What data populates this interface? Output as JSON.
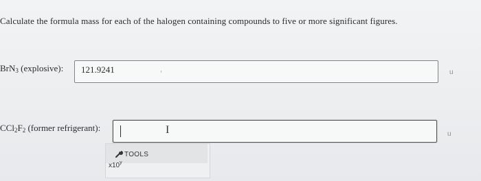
{
  "question": {
    "text": "Calculate the formula mass for each of the halogen containing compounds to five or more significant figures."
  },
  "rows": [
    {
      "formula_parts": [
        "BrN",
        "3"
      ],
      "descriptor": "(explosive):",
      "value": "121.9241",
      "unit": "u"
    },
    {
      "formula_parts": [
        "CCl",
        "2",
        "F",
        "2"
      ],
      "descriptor": "(former refrigerant):",
      "value": "",
      "unit": "u"
    }
  ],
  "tools": {
    "label": "TOOLS",
    "icon": "wrench-icon",
    "sci_notation": "x10",
    "sci_exponent": "y"
  }
}
